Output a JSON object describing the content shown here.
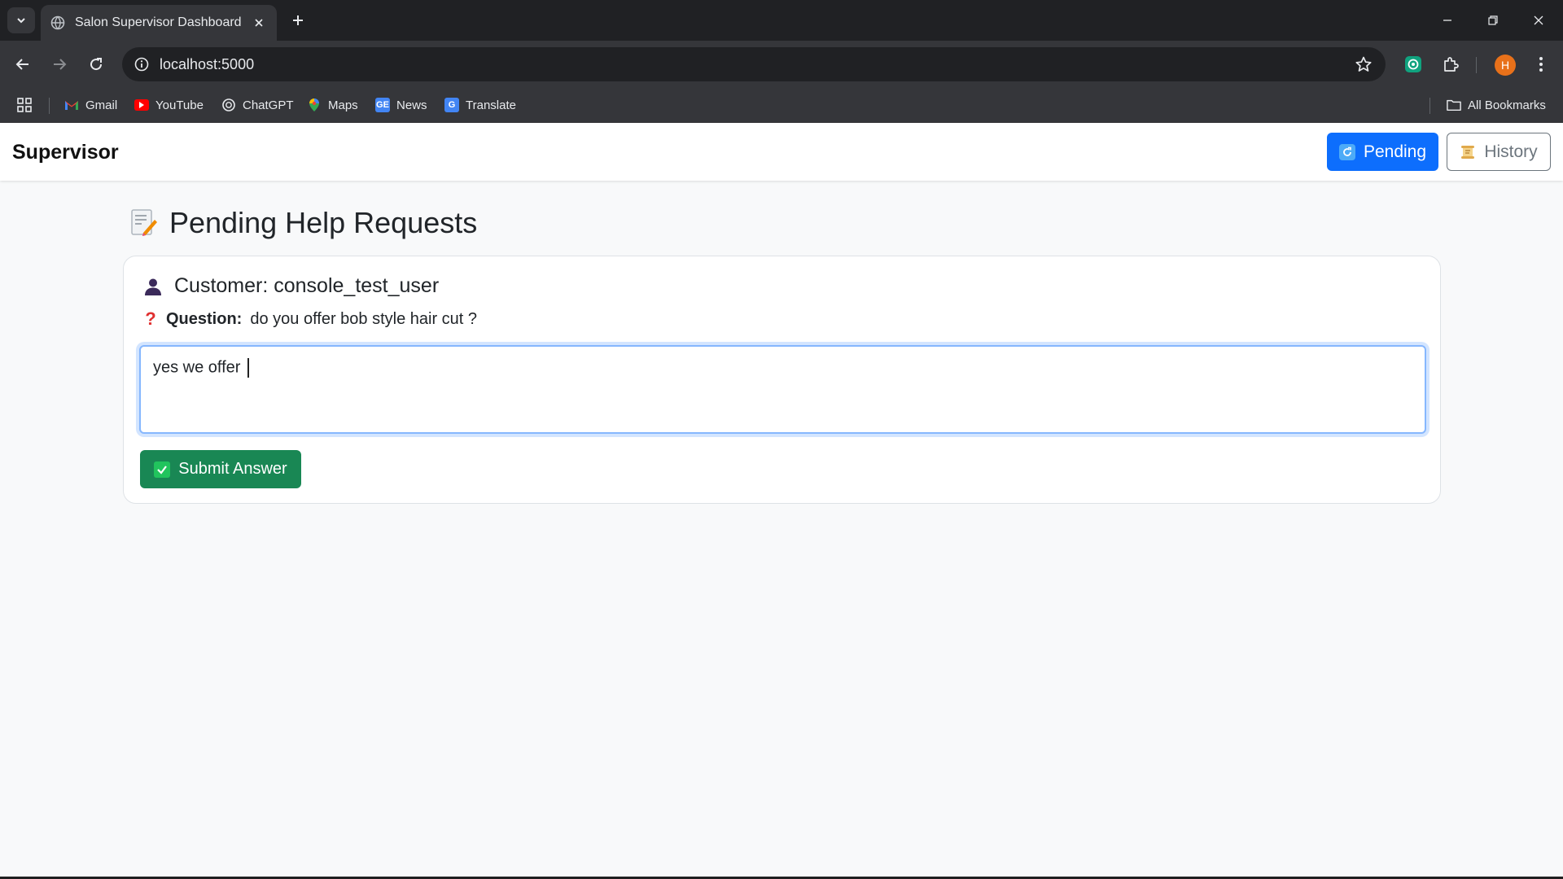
{
  "browser": {
    "tab_title": "Salon Supervisor Dashboard",
    "url": "localhost:5000",
    "profile_initial": "H",
    "bookmarks": [
      {
        "label": "Gmail",
        "icon": "gmail-icon"
      },
      {
        "label": "YouTube",
        "icon": "youtube-icon"
      },
      {
        "label": "ChatGPT",
        "icon": "chatgpt-icon"
      },
      {
        "label": "Maps",
        "icon": "maps-icon"
      },
      {
        "label": "News",
        "icon": "news-icon"
      },
      {
        "label": "Translate",
        "icon": "translate-icon"
      }
    ],
    "all_bookmarks_label": "All Bookmarks"
  },
  "app": {
    "brand": "Supervisor",
    "nav": {
      "pending_label": "Pending",
      "history_label": "History"
    },
    "page_title": "Pending Help Requests",
    "request": {
      "customer_label": "Customer: console_test_user",
      "question_label": "Question:",
      "question_text": "do you offer bob style hair cut ?",
      "answer_value": "yes we offer ",
      "submit_label": "Submit Answer"
    }
  },
  "colors": {
    "primary": "#0d6efd",
    "success": "#198754",
    "secondary": "#6c757d",
    "focus_ring": "#86b7fe"
  }
}
